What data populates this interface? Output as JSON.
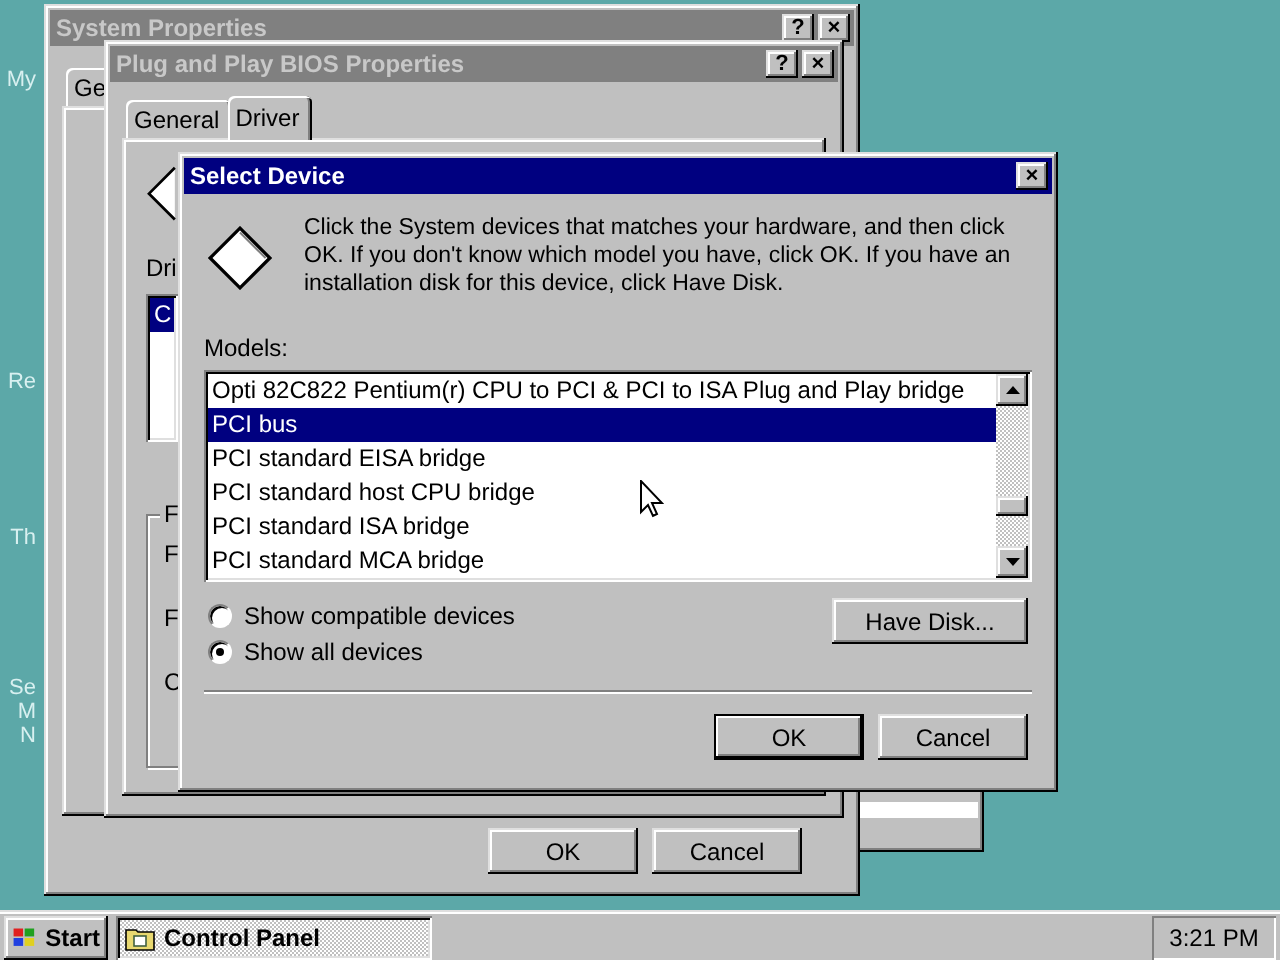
{
  "desktop_icons": [
    {
      "lines": [
        "My"
      ]
    },
    {
      "lines": [
        "Re"
      ]
    },
    {
      "lines": [
        "Th"
      ]
    },
    {
      "lines": [
        "Se",
        "M",
        "N"
      ]
    }
  ],
  "system_properties": {
    "title": "System Properties",
    "active": false,
    "title_buttons": [
      "?",
      "×"
    ],
    "tabs": [
      {
        "label": "Ge",
        "selected": false
      }
    ],
    "buttons": [
      "OK",
      "Cancel"
    ]
  },
  "pnp_properties": {
    "title": "Plug and Play BIOS Properties",
    "active": false,
    "title_buttons": [
      "?",
      "×"
    ],
    "tabs": [
      {
        "label": "General",
        "selected": false
      },
      {
        "label": "Driver",
        "selected": true
      }
    ],
    "list_label": "Dri",
    "list_items": [
      {
        "text": "C",
        "selected": true
      }
    ],
    "group_label": "F",
    "group_rows": [
      "F",
      "F",
      "C"
    ]
  },
  "select_device": {
    "title": "Select Device",
    "active": true,
    "title_buttons": [
      "×"
    ],
    "message": "Click the System devices that matches your hardware, and then click OK. If you don't know which model you have, click OK. If you have an installation disk for this device, click Have Disk.",
    "models_label": "Models:",
    "models": [
      {
        "text": "Opti 82C822 Pentium(r) CPU to PCI & PCI to ISA Plug and Play bridge",
        "selected": false
      },
      {
        "text": "PCI bus",
        "selected": true
      },
      {
        "text": "PCI standard EISA bridge",
        "selected": false
      },
      {
        "text": "PCI standard host CPU bridge",
        "selected": false
      },
      {
        "text": "PCI standard ISA bridge",
        "selected": false
      },
      {
        "text": "PCI standard MCA bridge",
        "selected": false
      }
    ],
    "options": [
      {
        "label": "Show compatible devices",
        "selected": false
      },
      {
        "label": "Show all devices",
        "selected": true
      }
    ],
    "have_disk": "Have Disk...",
    "buttons": [
      {
        "label": "OK",
        "default": true
      },
      {
        "label": "Cancel",
        "default": false
      }
    ]
  },
  "taskbar": {
    "start": "Start",
    "tasks": [
      {
        "label": "Control Panel",
        "selected": true
      }
    ],
    "clock": "3:21 PM"
  }
}
